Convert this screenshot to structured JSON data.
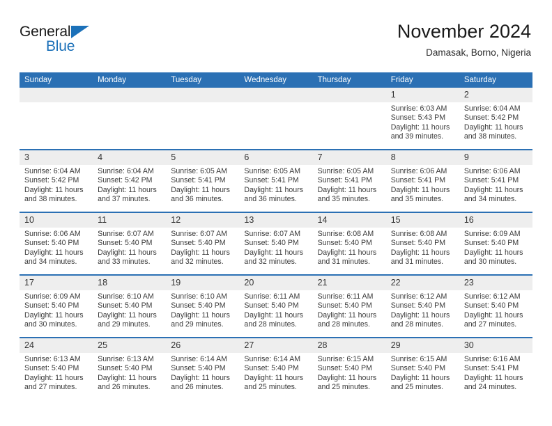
{
  "brand": {
    "name_top": "General",
    "name_bottom": "Blue",
    "accent_color": "#1c71b9"
  },
  "header": {
    "title": "November 2024",
    "subtitle": "Damasak, Borno, Nigeria"
  },
  "theme": {
    "header_row_bg": "#2b70b4",
    "daynum_bg": "#eeeeee",
    "text_color": "#333333"
  },
  "weekday_headers": [
    "Sunday",
    "Monday",
    "Tuesday",
    "Wednesday",
    "Thursday",
    "Friday",
    "Saturday"
  ],
  "weeks": [
    [
      {
        "day": "",
        "sunrise": "",
        "sunset": "",
        "daylight_line1": "",
        "daylight_line2": ""
      },
      {
        "day": "",
        "sunrise": "",
        "sunset": "",
        "daylight_line1": "",
        "daylight_line2": ""
      },
      {
        "day": "",
        "sunrise": "",
        "sunset": "",
        "daylight_line1": "",
        "daylight_line2": ""
      },
      {
        "day": "",
        "sunrise": "",
        "sunset": "",
        "daylight_line1": "",
        "daylight_line2": ""
      },
      {
        "day": "",
        "sunrise": "",
        "sunset": "",
        "daylight_line1": "",
        "daylight_line2": ""
      },
      {
        "day": "1",
        "sunrise": "Sunrise: 6:03 AM",
        "sunset": "Sunset: 5:43 PM",
        "daylight_line1": "Daylight: 11 hours",
        "daylight_line2": "and 39 minutes."
      },
      {
        "day": "2",
        "sunrise": "Sunrise: 6:04 AM",
        "sunset": "Sunset: 5:42 PM",
        "daylight_line1": "Daylight: 11 hours",
        "daylight_line2": "and 38 minutes."
      }
    ],
    [
      {
        "day": "3",
        "sunrise": "Sunrise: 6:04 AM",
        "sunset": "Sunset: 5:42 PM",
        "daylight_line1": "Daylight: 11 hours",
        "daylight_line2": "and 38 minutes."
      },
      {
        "day": "4",
        "sunrise": "Sunrise: 6:04 AM",
        "sunset": "Sunset: 5:42 PM",
        "daylight_line1": "Daylight: 11 hours",
        "daylight_line2": "and 37 minutes."
      },
      {
        "day": "5",
        "sunrise": "Sunrise: 6:05 AM",
        "sunset": "Sunset: 5:41 PM",
        "daylight_line1": "Daylight: 11 hours",
        "daylight_line2": "and 36 minutes."
      },
      {
        "day": "6",
        "sunrise": "Sunrise: 6:05 AM",
        "sunset": "Sunset: 5:41 PM",
        "daylight_line1": "Daylight: 11 hours",
        "daylight_line2": "and 36 minutes."
      },
      {
        "day": "7",
        "sunrise": "Sunrise: 6:05 AM",
        "sunset": "Sunset: 5:41 PM",
        "daylight_line1": "Daylight: 11 hours",
        "daylight_line2": "and 35 minutes."
      },
      {
        "day": "8",
        "sunrise": "Sunrise: 6:06 AM",
        "sunset": "Sunset: 5:41 PM",
        "daylight_line1": "Daylight: 11 hours",
        "daylight_line2": "and 35 minutes."
      },
      {
        "day": "9",
        "sunrise": "Sunrise: 6:06 AM",
        "sunset": "Sunset: 5:41 PM",
        "daylight_line1": "Daylight: 11 hours",
        "daylight_line2": "and 34 minutes."
      }
    ],
    [
      {
        "day": "10",
        "sunrise": "Sunrise: 6:06 AM",
        "sunset": "Sunset: 5:40 PM",
        "daylight_line1": "Daylight: 11 hours",
        "daylight_line2": "and 34 minutes."
      },
      {
        "day": "11",
        "sunrise": "Sunrise: 6:07 AM",
        "sunset": "Sunset: 5:40 PM",
        "daylight_line1": "Daylight: 11 hours",
        "daylight_line2": "and 33 minutes."
      },
      {
        "day": "12",
        "sunrise": "Sunrise: 6:07 AM",
        "sunset": "Sunset: 5:40 PM",
        "daylight_line1": "Daylight: 11 hours",
        "daylight_line2": "and 32 minutes."
      },
      {
        "day": "13",
        "sunrise": "Sunrise: 6:07 AM",
        "sunset": "Sunset: 5:40 PM",
        "daylight_line1": "Daylight: 11 hours",
        "daylight_line2": "and 32 minutes."
      },
      {
        "day": "14",
        "sunrise": "Sunrise: 6:08 AM",
        "sunset": "Sunset: 5:40 PM",
        "daylight_line1": "Daylight: 11 hours",
        "daylight_line2": "and 31 minutes."
      },
      {
        "day": "15",
        "sunrise": "Sunrise: 6:08 AM",
        "sunset": "Sunset: 5:40 PM",
        "daylight_line1": "Daylight: 11 hours",
        "daylight_line2": "and 31 minutes."
      },
      {
        "day": "16",
        "sunrise": "Sunrise: 6:09 AM",
        "sunset": "Sunset: 5:40 PM",
        "daylight_line1": "Daylight: 11 hours",
        "daylight_line2": "and 30 minutes."
      }
    ],
    [
      {
        "day": "17",
        "sunrise": "Sunrise: 6:09 AM",
        "sunset": "Sunset: 5:40 PM",
        "daylight_line1": "Daylight: 11 hours",
        "daylight_line2": "and 30 minutes."
      },
      {
        "day": "18",
        "sunrise": "Sunrise: 6:10 AM",
        "sunset": "Sunset: 5:40 PM",
        "daylight_line1": "Daylight: 11 hours",
        "daylight_line2": "and 29 minutes."
      },
      {
        "day": "19",
        "sunrise": "Sunrise: 6:10 AM",
        "sunset": "Sunset: 5:40 PM",
        "daylight_line1": "Daylight: 11 hours",
        "daylight_line2": "and 29 minutes."
      },
      {
        "day": "20",
        "sunrise": "Sunrise: 6:11 AM",
        "sunset": "Sunset: 5:40 PM",
        "daylight_line1": "Daylight: 11 hours",
        "daylight_line2": "and 28 minutes."
      },
      {
        "day": "21",
        "sunrise": "Sunrise: 6:11 AM",
        "sunset": "Sunset: 5:40 PM",
        "daylight_line1": "Daylight: 11 hours",
        "daylight_line2": "and 28 minutes."
      },
      {
        "day": "22",
        "sunrise": "Sunrise: 6:12 AM",
        "sunset": "Sunset: 5:40 PM",
        "daylight_line1": "Daylight: 11 hours",
        "daylight_line2": "and 28 minutes."
      },
      {
        "day": "23",
        "sunrise": "Sunrise: 6:12 AM",
        "sunset": "Sunset: 5:40 PM",
        "daylight_line1": "Daylight: 11 hours",
        "daylight_line2": "and 27 minutes."
      }
    ],
    [
      {
        "day": "24",
        "sunrise": "Sunrise: 6:13 AM",
        "sunset": "Sunset: 5:40 PM",
        "daylight_line1": "Daylight: 11 hours",
        "daylight_line2": "and 27 minutes."
      },
      {
        "day": "25",
        "sunrise": "Sunrise: 6:13 AM",
        "sunset": "Sunset: 5:40 PM",
        "daylight_line1": "Daylight: 11 hours",
        "daylight_line2": "and 26 minutes."
      },
      {
        "day": "26",
        "sunrise": "Sunrise: 6:14 AM",
        "sunset": "Sunset: 5:40 PM",
        "daylight_line1": "Daylight: 11 hours",
        "daylight_line2": "and 26 minutes."
      },
      {
        "day": "27",
        "sunrise": "Sunrise: 6:14 AM",
        "sunset": "Sunset: 5:40 PM",
        "daylight_line1": "Daylight: 11 hours",
        "daylight_line2": "and 25 minutes."
      },
      {
        "day": "28",
        "sunrise": "Sunrise: 6:15 AM",
        "sunset": "Sunset: 5:40 PM",
        "daylight_line1": "Daylight: 11 hours",
        "daylight_line2": "and 25 minutes."
      },
      {
        "day": "29",
        "sunrise": "Sunrise: 6:15 AM",
        "sunset": "Sunset: 5:40 PM",
        "daylight_line1": "Daylight: 11 hours",
        "daylight_line2": "and 25 minutes."
      },
      {
        "day": "30",
        "sunrise": "Sunrise: 6:16 AM",
        "sunset": "Sunset: 5:41 PM",
        "daylight_line1": "Daylight: 11 hours",
        "daylight_line2": "and 24 minutes."
      }
    ]
  ]
}
